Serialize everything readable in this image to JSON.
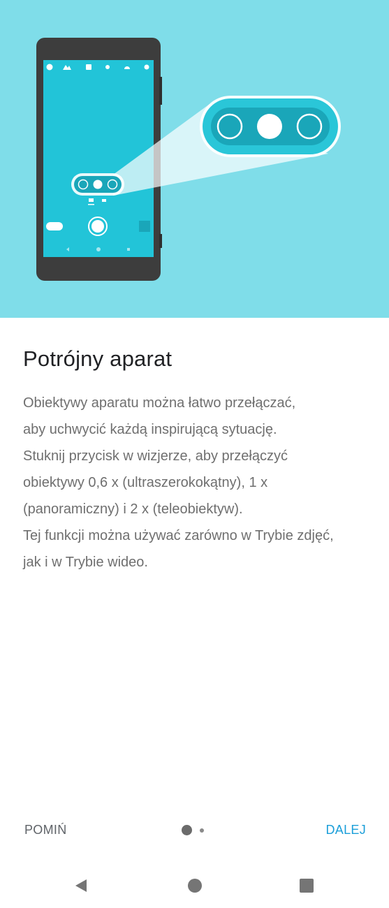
{
  "illustration": {
    "icon_names": [
      "flash-icon",
      "scene-icon",
      "aspect-ratio-icon",
      "hdr-icon",
      "switch-camera-icon",
      "settings-icon"
    ],
    "colors": {
      "background": "#7fdde9",
      "phone_body": "#3d3d3d",
      "screen": "#22c4d8",
      "lens_selector": "#1aa6b9"
    }
  },
  "content": {
    "title": "Potrójny aparat",
    "lines": [
      "Obiektywy aparatu można łatwo przełączać,",
      "aby uchwycić każdą inspirującą sytuację.",
      "Stuknij przycisk w wizjerze, aby przełączyć",
      "obiektywy 0,6 x (ultraszerokokątny), 1 x",
      "(panoramiczny) i 2 x (teleobiektyw).",
      "Tej funkcji można używać zarówno w Trybie zdjęć,",
      "jak i w Trybie wideo."
    ]
  },
  "footer": {
    "skip_label": "POMIŃ",
    "next_label": "DALEJ",
    "page_current": 1,
    "page_total": 2
  },
  "navbar": {
    "icons": [
      "back-icon",
      "home-icon",
      "recents-icon"
    ]
  }
}
